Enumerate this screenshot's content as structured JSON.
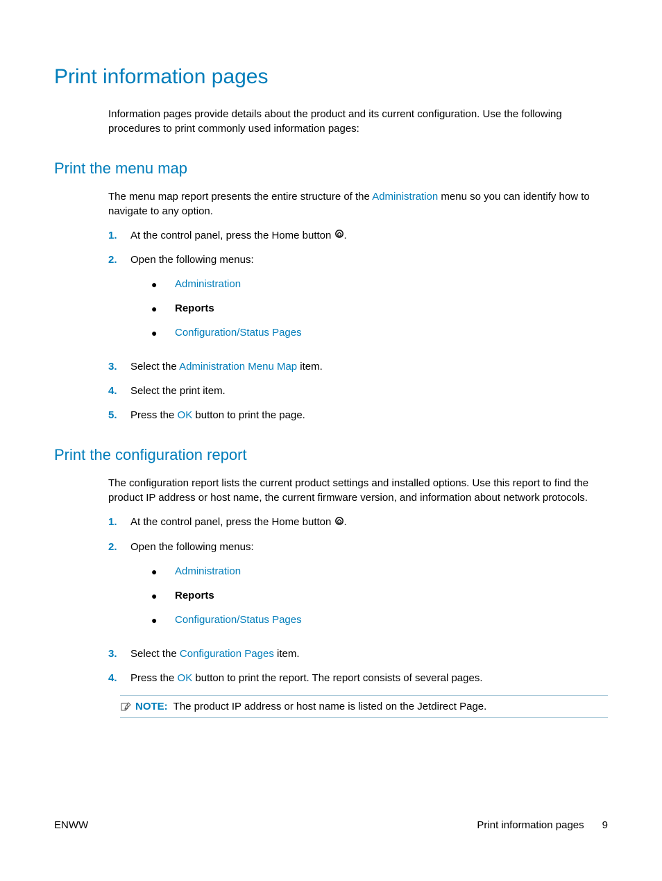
{
  "title": "Print information pages",
  "intro": "Information pages provide details about the product and its current configuration. Use the following procedures to print commonly used information pages:",
  "section1": {
    "heading": "Print the menu map",
    "intro_pre": "The menu map report presents the entire structure of the ",
    "intro_link": "Administration",
    "intro_post": " menu so you can identify how to navigate to any option.",
    "step1_num": "1.",
    "step1_pre": "At the control panel, press the Home button ",
    "step1_post": ".",
    "step2_num": "2.",
    "step2_text": "Open the following menus:",
    "bullet_admin": "Administration",
    "bullet_reports": "Reports",
    "bullet_config": "Configuration/Status Pages",
    "step3_num": "3.",
    "step3_pre": "Select the ",
    "step3_link": "Administration Menu Map",
    "step3_post": " item.",
    "step4_num": "4.",
    "step4_text": "Select the print item.",
    "step5_num": "5.",
    "step5_pre": "Press the ",
    "step5_link": "OK",
    "step5_post": " button to print the page."
  },
  "section2": {
    "heading": "Print the configuration report",
    "intro": "The configuration report lists the current product settings and installed options. Use this report to find the product IP address or host name, the current firmware version, and information about network protocols.",
    "step1_num": "1.",
    "step1_pre": "At the control panel, press the Home button ",
    "step1_post": ".",
    "step2_num": "2.",
    "step2_text": "Open the following menus:",
    "bullet_admin": "Administration",
    "bullet_reports": "Reports",
    "bullet_config": "Configuration/Status Pages",
    "step3_num": "3.",
    "step3_pre": "Select the ",
    "step3_link": "Configuration Pages",
    "step3_post": " item.",
    "step4_num": "4.",
    "step4_pre": "Press the ",
    "step4_link": "OK",
    "step4_post": " button to print the report. The report consists of several pages.",
    "note_label": "NOTE:",
    "note_text": "The product IP address or host name is listed on the Jetdirect Page."
  },
  "footer": {
    "left": "ENWW",
    "right_title": "Print information pages",
    "page": "9"
  }
}
